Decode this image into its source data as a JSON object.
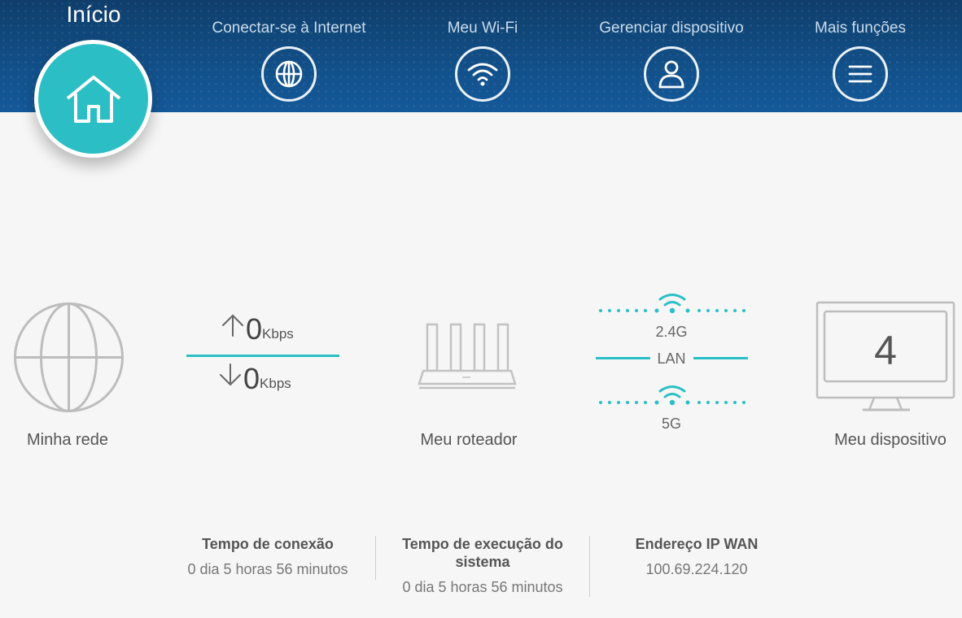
{
  "nav": {
    "home_label": "Início",
    "items": [
      {
        "label": "Conectar-se à Internet",
        "icon": "globe-icon"
      },
      {
        "label": "Meu Wi-Fi",
        "icon": "wifi-icon"
      },
      {
        "label": "Gerenciar dispositivo",
        "icon": "user-icon"
      },
      {
        "label": "Mais funções",
        "icon": "menu-icon"
      }
    ]
  },
  "topology": {
    "network_label": "Minha rede",
    "upload": {
      "value": "0",
      "unit": "Kbps"
    },
    "download": {
      "value": "0",
      "unit": "Kbps"
    },
    "router_label": "Meu roteador",
    "band_24": "2.4G",
    "lan": "LAN",
    "band_5": "5G",
    "device_count": "4",
    "device_label": "Meu dispositivo"
  },
  "info": {
    "connection_time_title": "Tempo de conexão",
    "connection_time_value": "0 dia 5 horas 56 minutos",
    "uptime_title": "Tempo de execução do sistema",
    "uptime_value": "0 dia 5 horas 56 minutos",
    "wan_ip_title": "Endereço IP WAN",
    "wan_ip_value": "100.69.224.120"
  },
  "colors": {
    "accent": "#2bbfc5",
    "header": "#125089"
  }
}
